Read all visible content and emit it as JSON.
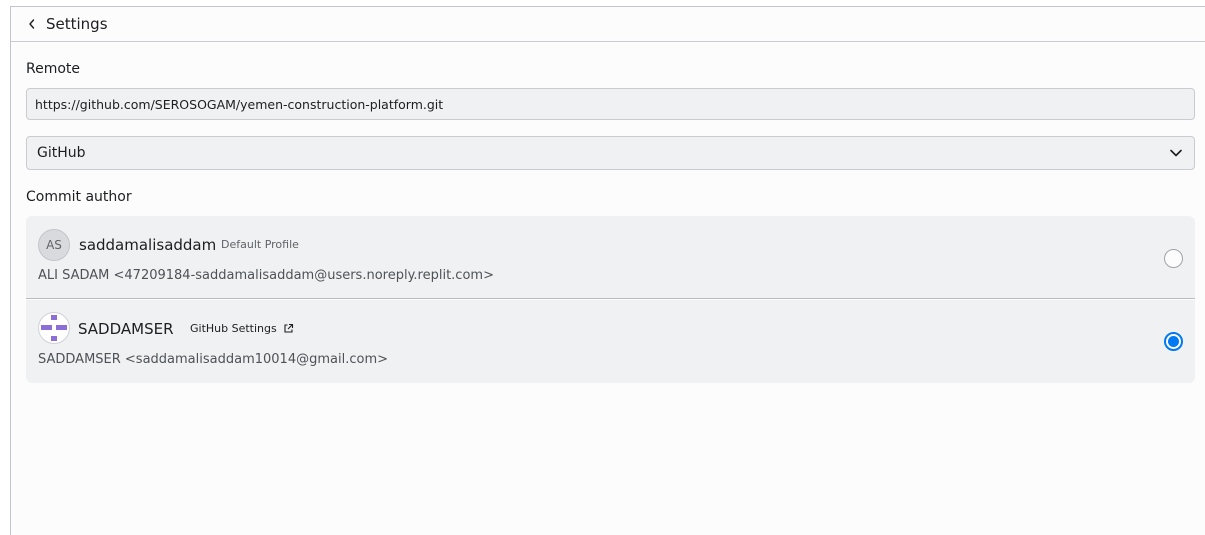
{
  "header": {
    "back_icon": "chevron-left-icon",
    "title": "Settings"
  },
  "remote": {
    "label": "Remote",
    "url": "https://github.com/SEROSOGAM/yemen-construction-platform.git"
  },
  "provider": {
    "selected": "GitHub",
    "icon": "chevron-down-icon"
  },
  "commit_author": {
    "label": "Commit author",
    "authors": [
      {
        "avatar_initials": "AS",
        "username": "saddamalisaddam",
        "tag": "Default Profile",
        "email_line": "ALI SADAM <47209184-saddamalisaddam@users.noreply.replit.com>",
        "selected": false
      },
      {
        "avatar": "identicon",
        "username": "SADDAMSER",
        "tag": "GitHub Settings",
        "tag_icon": "external-link-icon",
        "email_line": "SADDAMSER <saddamalisaddam10014@gmail.com>",
        "selected": true
      }
    ]
  },
  "colors": {
    "accent": "#0079f2",
    "panel_bg": "#fcfcfc",
    "field_bg": "#f0f1f2",
    "identicon": "#8b6ed8"
  }
}
